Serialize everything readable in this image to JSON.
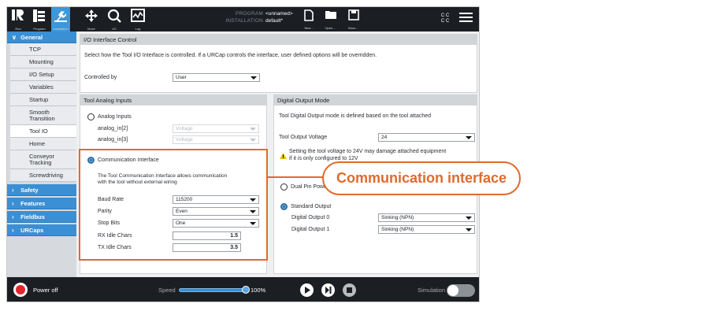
{
  "topbar": {
    "nav": [
      {
        "label": "Run",
        "icon": "ur-logo-icon"
      },
      {
        "label": "Program",
        "icon": "program-icon"
      },
      {
        "label": "Installation",
        "icon": "installation-icon"
      },
      {
        "label": "Move",
        "icon": "move-icon"
      },
      {
        "label": "I/O",
        "icon": "io-icon"
      },
      {
        "label": "Log",
        "icon": "log-icon"
      }
    ],
    "program_key": "PROGRAM",
    "program_value": "<unnamed>",
    "installation_key": "INSTALLATION",
    "installation_value": "default*",
    "file_buttons": [
      {
        "label": "New...",
        "icon": "new-file-icon"
      },
      {
        "label": "Open...",
        "icon": "open-folder-icon"
      },
      {
        "label": "Save...",
        "icon": "save-icon"
      }
    ],
    "cc_top": "C C",
    "cc_bottom": "C C"
  },
  "sidebar": {
    "general_label": "General",
    "items": [
      "TCP",
      "Mounting",
      "I/O Setup",
      "Variables",
      "Startup",
      "Smooth Transition",
      "Tool IO",
      "Home",
      "Conveyor Tracking",
      "Screwdriving"
    ],
    "selected": "Tool IO",
    "groups": [
      "Safety",
      "Features",
      "Fieldbus",
      "URCaps"
    ]
  },
  "io_interface": {
    "title": "I/O Interface Control",
    "description": "Select how the Tool I/O Interface is controlled. If a URCap controls the interface, user defined options will be overridden.",
    "controlled_by_label": "Controlled by",
    "controlled_by_value": "User"
  },
  "analog": {
    "title": "Tool Analog Inputs",
    "analog_inputs_label": "Analog Inputs",
    "rows": [
      {
        "label": "analog_in[2]",
        "value": "Voltage"
      },
      {
        "label": "analog_in[3]",
        "value": "Voltage"
      }
    ],
    "comm_label": "Communication Interface",
    "comm_desc_1": "The Tool Communication Interface allows communication",
    "comm_desc_2": "with the tool without external wiring",
    "settings": [
      {
        "label": "Baud Rate",
        "value": "115200"
      },
      {
        "label": "Parity",
        "value": "Even"
      },
      {
        "label": "Stop Bits",
        "value": "One"
      }
    ],
    "rx_label": "RX Idle Chars",
    "rx_value": "1.5",
    "tx_label": "TX Idle Chars",
    "tx_value": "3.5"
  },
  "digital": {
    "title": "Digital Output Mode",
    "description": "Tool Digital Output mode is defined based on the tool attached",
    "voltage_label": "Tool Output Voltage",
    "voltage_value": "24",
    "warning_1": "Setting the tool voltage to 24V may damage attached equipment",
    "warning_2": "if it is only configured to 12V",
    "dual_pin_label": "Dual Pin Power",
    "standard_label": "Standard Output",
    "outputs": [
      {
        "label": "Digital Output 0",
        "value": "Sinking (NPN)"
      },
      {
        "label": "Digital Output 1",
        "value": "Sinking (NPN)"
      }
    ]
  },
  "callout": {
    "text": "Communication interface"
  },
  "bottombar": {
    "power_label": "Power off",
    "speed_label": "Speed",
    "speed_value": "100%",
    "speed_fraction": 1.0,
    "simulation_label": "Simulation"
  },
  "colors": {
    "accent": "#3b8fd4",
    "callout": "#e06a2d",
    "bar": "#1b1e23"
  }
}
